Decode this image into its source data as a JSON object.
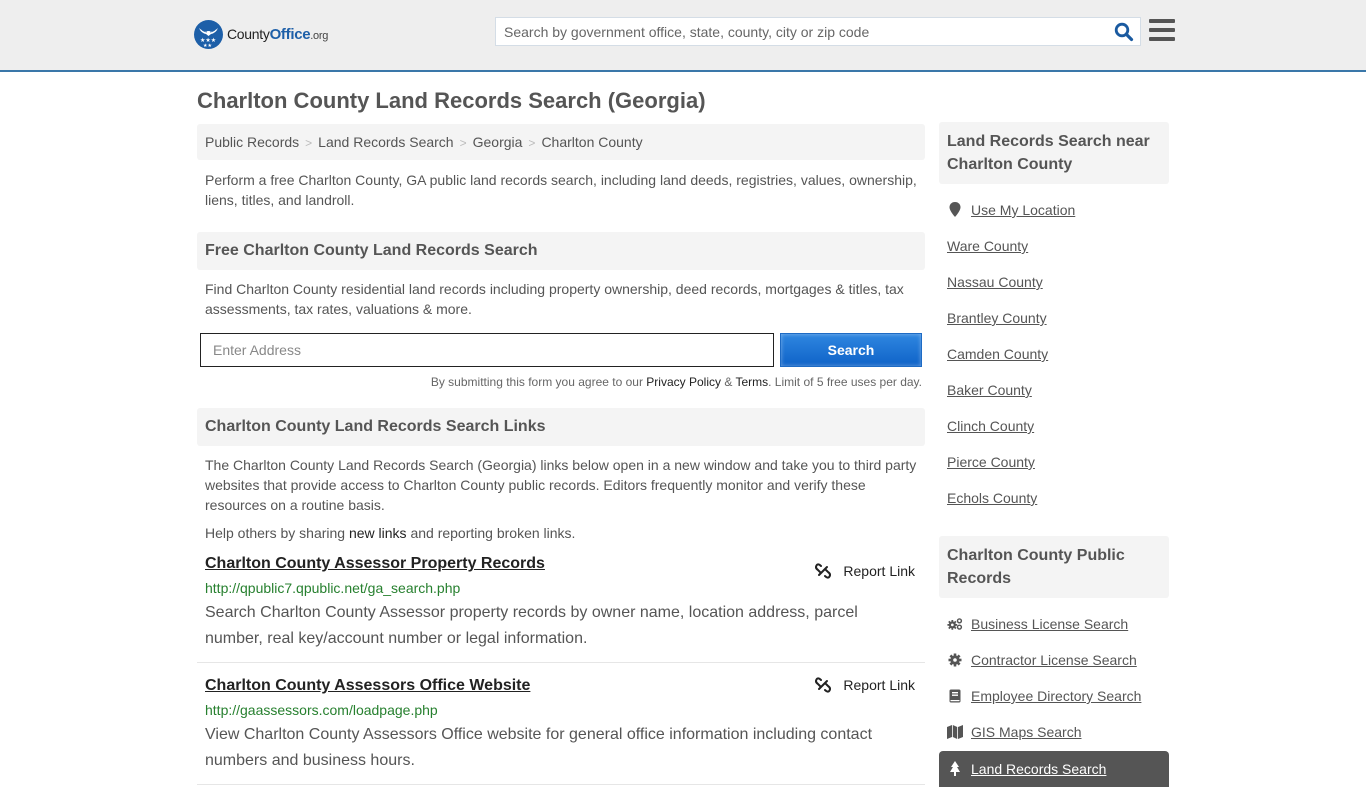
{
  "header": {
    "logo_prefix": "County",
    "logo_brand": "Office",
    "logo_suffix": ".org",
    "search_placeholder": "Search by government office, state, county, city or zip code",
    "search_icon": "search-icon",
    "menu_icon": "hamburger-menu-icon",
    "accent_color": "#3a77a9"
  },
  "page": {
    "title": "Charlton County Land Records Search (Georgia)"
  },
  "breadcrumb": [
    {
      "label": "Public Records"
    },
    {
      "label": "Land Records Search"
    },
    {
      "label": "Georgia"
    },
    {
      "label": "Charlton County"
    }
  ],
  "breadcrumb_separator": ">",
  "intro": "Perform a free Charlton County, GA public land records search, including land deeds, registries, values, ownership, liens, titles, and landroll.",
  "search_section": {
    "heading": "Free Charlton County Land Records Search",
    "description": "Find Charlton County residential land records including property ownership, deed records, mortgages & titles, tax assessments, tax rates, valuations & more.",
    "address_placeholder": "Enter Address",
    "address_value": "",
    "button_label": "Search",
    "button_color": "#1a6fd0",
    "terms_prefix": "By submitting this form you agree to our",
    "privacy_label": "Privacy Policy",
    "amp": "&",
    "terms_label": "Terms",
    "terms_suffix": ". Limit of 5 free uses per day."
  },
  "links_section": {
    "heading": "Charlton County Land Records Search Links",
    "description": "The Charlton County Land Records Search (Georgia) links below open in a new window and take you to third party websites that provide access to Charlton County public records. Editors frequently monitor and verify these resources on a routine basis.",
    "help_prefix": "Help others by sharing",
    "help_link": "new links",
    "help_suffix": "and reporting broken links.",
    "report_label": "Report Link",
    "items": [
      {
        "title": "Charlton County Assessor Property Records",
        "url": "http://qpublic7.qpublic.net/ga_search.php",
        "description": "Search Charlton County Assessor property records by owner name, location address, parcel number, real key/account number or legal information."
      },
      {
        "title": "Charlton County Assessors Office Website",
        "url": "http://gaassessors.com/loadpage.php",
        "description": "View Charlton County Assessors Office website for general office information including contact numbers and business hours."
      }
    ]
  },
  "sidebar": {
    "near_heading": "Land Records Search near Charlton County",
    "use_location": "Use My Location",
    "nearby": [
      "Ware County",
      "Nassau County",
      "Brantley County",
      "Camden County",
      "Baker County",
      "Clinch County",
      "Pierce County",
      "Echols County"
    ],
    "public_heading": "Charlton County Public Records",
    "public_records": [
      {
        "label": "Business License Search",
        "icon": "cogs-icon"
      },
      {
        "label": "Contractor License Search",
        "icon": "gear-icon"
      },
      {
        "label": "Employee Directory Search",
        "icon": "book-icon"
      },
      {
        "label": "GIS Maps Search",
        "icon": "map-icon"
      },
      {
        "label": "Land Records Search",
        "icon": "tree-icon",
        "active": true
      }
    ]
  }
}
